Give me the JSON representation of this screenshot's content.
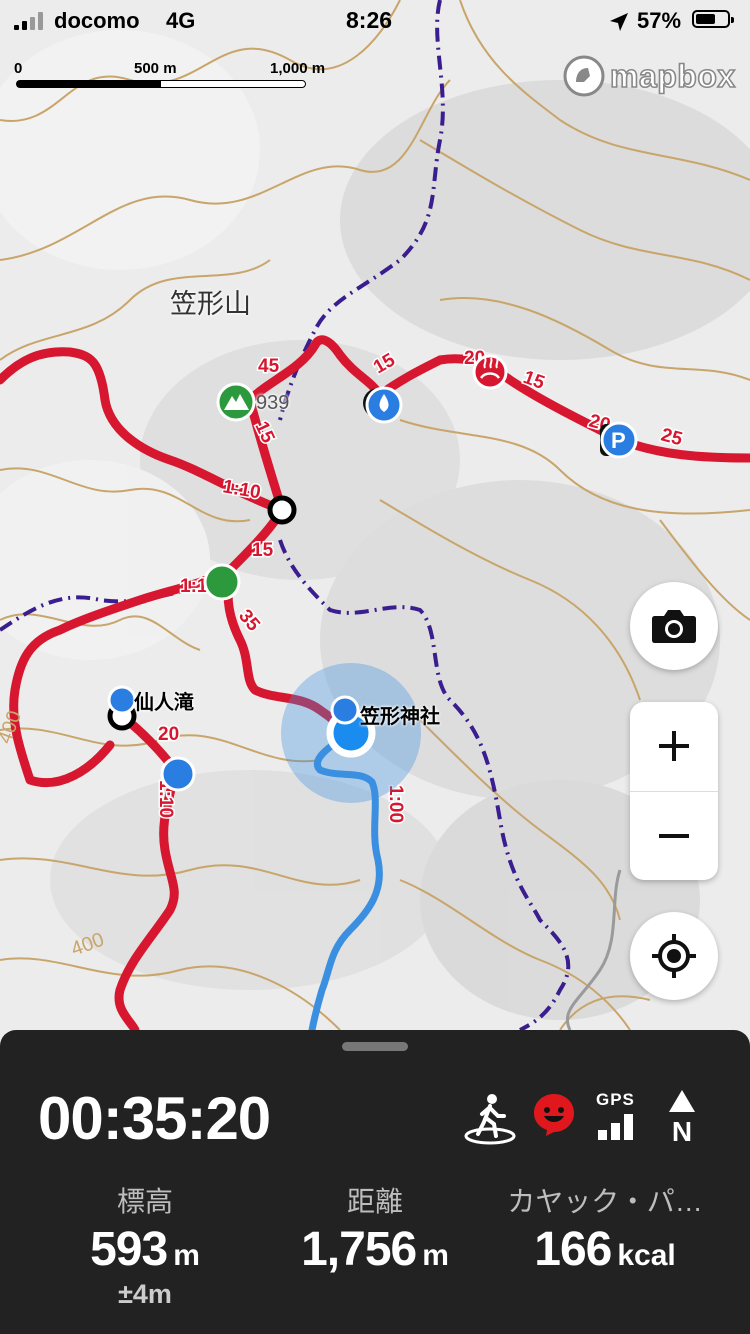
{
  "status_bar": {
    "carrier": "docomo",
    "network": "4G",
    "time": "8:26",
    "battery_percent": "57%"
  },
  "scale_bar": {
    "labels": [
      "0",
      "500 m",
      "1,000 m"
    ]
  },
  "attribution": {
    "logo_text": "mapbox"
  },
  "map": {
    "peak_name": "笠形山",
    "peak_elevation": "939",
    "shrine_label": "笠形神社",
    "waterfall_label": "仙人滝",
    "contour_labels": [
      "400",
      "400"
    ],
    "course_times": [
      "45",
      "15",
      "20",
      "15",
      "20",
      "25",
      "15",
      "1:10",
      "15",
      "1:10",
      "35",
      "20",
      "1:10",
      "1:00"
    ],
    "colors": {
      "course": "#d7172f",
      "track": "#3b8fe0",
      "trail": "#3a1d8f",
      "contour": "#c8a56a",
      "location": "#1a8cf0"
    }
  },
  "controls": {
    "camera_icon": "camera-icon",
    "zoom_in_icon": "plus-icon",
    "zoom_out_icon": "minus-icon",
    "locate_icon": "crosshair-icon"
  },
  "panel": {
    "elapsed_time": "00:35:20",
    "stats": [
      {
        "label": "標高",
        "value": "593",
        "unit": "m",
        "sub": "±4m"
      },
      {
        "label": "距離",
        "value": "1,756",
        "unit": "m"
      },
      {
        "label": "カヤック・パ…",
        "value": "166",
        "unit": "kcal"
      }
    ],
    "indicators": {
      "activity_icon": "hiker-icon",
      "mood_icon": "smiley-icon",
      "gps_label": "GPS",
      "north_label": "N"
    }
  }
}
